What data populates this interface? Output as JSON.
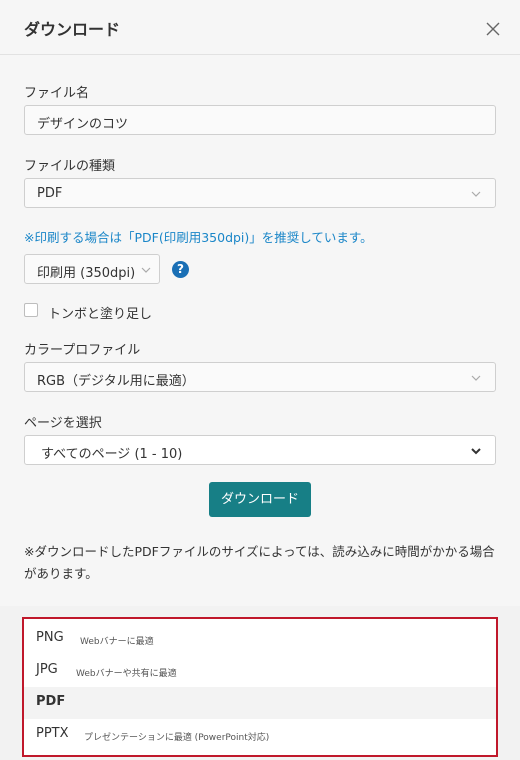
{
  "dialog": {
    "title": "ダウンロード",
    "close_icon": "close-icon"
  },
  "file_name": {
    "label": "ファイル名",
    "value": "デザインのコツ"
  },
  "file_type": {
    "label": "ファイルの種類",
    "selected": "PDF"
  },
  "print_note": "※印刷する場合は「PDF(印刷用350dpi)」を推奨しています。",
  "quality": {
    "selected": "印刷用 (350dpi)",
    "help_icon": "question-circle-icon",
    "help_glyph": "?"
  },
  "bleed": {
    "label": "トンボと塗り足し",
    "checked": false
  },
  "color_profile": {
    "label": "カラープロファイル",
    "selected": "RGB（デジタル用に最適）"
  },
  "pages": {
    "label": "ページを選択",
    "selected": "すべてのページ (1 - 10)"
  },
  "download_button": "ダウンロード",
  "footnote": "※ダウンロードしたPDFファイルのサイズによっては、読み込みに時間がかかる場合があります。",
  "dropdown_options": [
    {
      "name": "PNG",
      "desc": "Webバナーに最適",
      "selected": false
    },
    {
      "name": "JPG",
      "desc": "Webバナーや共有に最適",
      "selected": false
    },
    {
      "name": "PDF",
      "desc": "",
      "selected": true
    },
    {
      "name": "PPTX",
      "desc": "プレゼンテーションに最適 (PowerPoint対応)",
      "selected": false
    }
  ],
  "colors": {
    "accent_button": "#177f86",
    "note_blue": "#1a86c8",
    "highlight_border": "#c0182b",
    "help_icon": "#1a6fb5"
  }
}
